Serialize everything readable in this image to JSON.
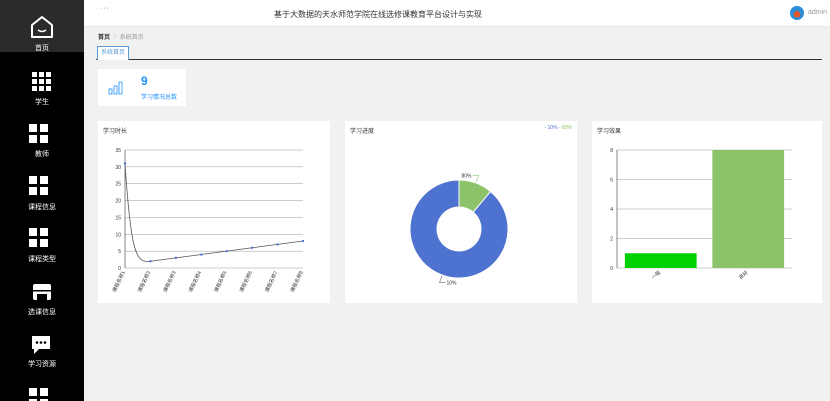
{
  "sidebar": {
    "items": [
      {
        "label": "首页",
        "icon": "home-icon"
      },
      {
        "label": "学生",
        "icon": "grid-icon"
      },
      {
        "label": "教师",
        "icon": "grid-icon"
      },
      {
        "label": "课程信息",
        "icon": "grid-icon"
      },
      {
        "label": "课程类型",
        "icon": "grid-icon"
      },
      {
        "label": "选课信息",
        "icon": "store-icon"
      },
      {
        "label": "学习资源",
        "icon": "chat-icon"
      }
    ]
  },
  "header": {
    "menu": "···",
    "title": "基于大数据的天水师范学院在线选修课教育平台设计与实现",
    "user": "admin"
  },
  "breadcrumb": {
    "home": "首页",
    "current": "系统首页"
  },
  "tabs": [
    {
      "label": "系统首页"
    }
  ],
  "stat": {
    "value": "9",
    "caption": "学习情况总数"
  },
  "panels": {
    "p1": {
      "title": "学习时长"
    },
    "p2": {
      "title": "学习进度",
      "legend_a": "10%",
      "legend_b": "80%"
    },
    "p3": {
      "title": "学习效果"
    }
  },
  "colors": {
    "accent": "#1e90ff",
    "blue": "#4e72d0",
    "green": "#8cc26a",
    "brightGreen": "#00d100"
  },
  "chart_data": [
    {
      "type": "line",
      "title": "学习时长",
      "categories": [
        "课程名称1",
        "课程名称2",
        "课程名称3",
        "课程名称4",
        "课程名称5",
        "课程名称6",
        "课程名称7",
        "课程名称8"
      ],
      "values": [
        31,
        2,
        3,
        4,
        5,
        6,
        7,
        8
      ],
      "ylim": [
        0,
        35
      ],
      "yticks": [
        0,
        5,
        10,
        15,
        20,
        25,
        30,
        35
      ],
      "grid": true
    },
    {
      "type": "pie",
      "title": "学习进度",
      "slices": [
        {
          "label": "10%",
          "value": 80
        },
        {
          "label": "80%",
          "value": 10
        }
      ],
      "legend": [
        "10%",
        "80%"
      ],
      "legend_position": "top-right"
    },
    {
      "type": "bar",
      "title": "学习效果",
      "categories": [
        "一般",
        "良好"
      ],
      "values": [
        1,
        8
      ],
      "ylim": [
        0,
        8
      ],
      "yticks": [
        0,
        2,
        4,
        6,
        8
      ]
    }
  ]
}
